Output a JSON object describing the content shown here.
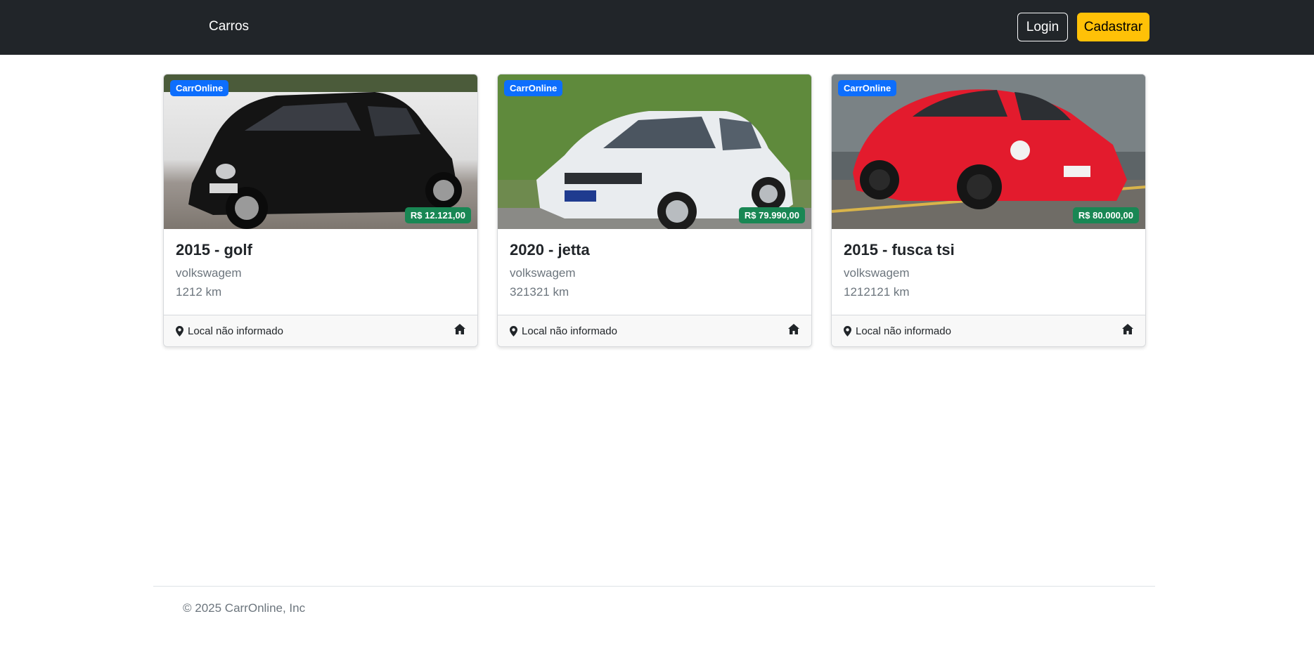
{
  "navbar": {
    "brand": "Carros",
    "login_label": "Login",
    "signup_label": "Cadastrar"
  },
  "colors": {
    "navbar_bg": "#212529",
    "signup_bg": "#ffc107",
    "brand_badge": "#0d6efd",
    "price_badge": "#198754"
  },
  "cars": [
    {
      "badge": "CarrOnline",
      "price": "R$ 12.121,00",
      "title": "2015 - golf",
      "brand": "volkswagem",
      "km": "1212 km",
      "location": "Local não informado",
      "image": "black-vw-golf-photo",
      "location_icon": "map-pin-icon",
      "action_icon": "house-icon"
    },
    {
      "badge": "CarrOnline",
      "price": "R$ 79.990,00",
      "title": "2020 - jetta",
      "brand": "volkswagem",
      "km": "321321 km",
      "location": "Local não informado",
      "image": "white-vw-jetta-photo",
      "location_icon": "map-pin-icon",
      "action_icon": "house-icon"
    },
    {
      "badge": "CarrOnline",
      "price": "R$ 80.000,00",
      "title": "2015 - fusca tsi",
      "brand": "volkswagem",
      "km": "1212121 km",
      "location": "Local não informado",
      "image": "red-vw-fusca-photo",
      "location_icon": "map-pin-icon",
      "action_icon": "house-icon"
    }
  ],
  "footer": {
    "copyright": "© 2025 CarrOnline, Inc"
  }
}
